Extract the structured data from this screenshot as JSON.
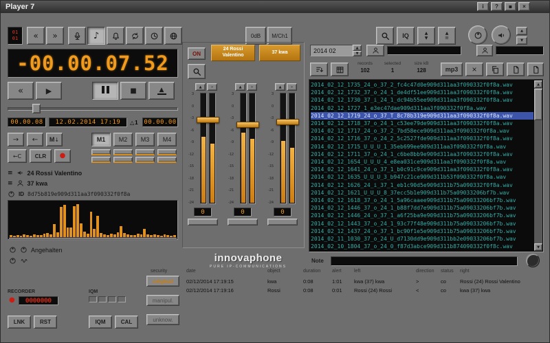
{
  "window": {
    "title": "Player 7",
    "titlebar": {
      "info": "i",
      "help": "?",
      "pin": "▪",
      "close": "×"
    }
  },
  "icons": {
    "prev": "«",
    "next": "»",
    "play": "▶",
    "stop": "■",
    "eject": "▲",
    "note": "♪",
    "record": "●",
    "up": "▲",
    "down": "▼",
    "close": "×",
    "menu": "≡",
    "m": "M",
    "m_arrow": "↓",
    "goto_fwd": "→",
    "goto_back": "←",
    "delta": "△"
  },
  "toolbar": {
    "channel_top": "01",
    "channel_bottom": "01",
    "gain_label": "0dB",
    "mode_label": "M/Ch1",
    "iq_label": "IQ"
  },
  "display": {
    "main": "-00.00.07.52",
    "elapsed": "00.00.08",
    "datetime": "12.02.2014 17:19",
    "take": "1",
    "remaining": "00.00.00"
  },
  "markers": {
    "c_label": "←C",
    "clr_label": "CLR",
    "m1": "M1",
    "m2": "M2",
    "m3": "M3",
    "m4": "M4"
  },
  "call_info": {
    "party_a": "24 Rossi Valentino",
    "party_b": "37 kwa",
    "id_label": "ID",
    "id_value": "8d75b819e909d311aa3f090332f0f8a"
  },
  "waveform": {
    "bars": [
      5,
      3,
      6,
      4,
      7,
      5,
      4,
      8,
      6,
      5,
      9,
      12,
      8,
      38,
      14,
      86,
      92,
      28,
      28,
      88,
      94,
      40,
      16,
      10,
      72,
      24,
      60,
      12,
      8,
      6,
      10,
      7,
      14,
      32,
      11,
      8,
      6,
      5,
      9,
      7,
      24,
      8,
      5,
      7,
      6,
      4,
      8,
      5,
      4,
      6
    ]
  },
  "status": {
    "text": "Angehalten"
  },
  "logo": {
    "name": "innovaphone",
    "tagline": "PURE IP-COMMUNICATIONS"
  },
  "recorder": {
    "label": "RECORDER",
    "counter": "0000000",
    "iqm_label": "IQM",
    "lnk": "LNK",
    "rst": "RST",
    "iqm_btn": "IQM",
    "cal": "CAL"
  },
  "meters": {
    "on_label": "ON",
    "headers": [
      "24 Rossi Valentino",
      "37 kwa"
    ],
    "scale": [
      "3",
      "0",
      "-3",
      "-6",
      "-9",
      "-12",
      "-15",
      "-18",
      "-21",
      "-24"
    ],
    "groups": [
      {
        "levels": [
          60,
          54
        ],
        "fader": 22,
        "value": "0"
      },
      {
        "levels": [
          64,
          58
        ],
        "fader": 26,
        "value": "0"
      },
      {
        "levels": [
          56,
          50
        ],
        "fader": 24,
        "value": "0"
      }
    ]
  },
  "browser": {
    "period": "2014 02",
    "stats": [
      {
        "label": "records",
        "value": "102"
      },
      {
        "label": "selected",
        "value": "1"
      },
      {
        "label": "size kB",
        "value": "128"
      }
    ],
    "mp3_label": "mp3",
    "selected_index": 4,
    "files": [
      "2014_02_12_1735_24_o_37_2_fc4c47d0e909d311aa3f090332f0f8a.wav",
      "2014_02_12_1732_37_o_24_1_de4df51ee909d311aa3f090332f0f8a.wav",
      "2014_02_12_1730_37_i_24_1_dc94b55ee909d311aa3f090332f0f8a.wav",
      "2014_02_12_1727_1_e3ec47dae909d311aa3f090332f0f8a.wav",
      "2014_02_12_1719_24_o_37_T_8c78b319e909d311aa3f090332f0f8a.wav",
      "2014_02_12_1718_37_o_24_1_c53ee79de909d311aa3f090332f0f8a.wav",
      "2014_02_12_1717_24_o_37_2_7bd58ece909d311aa3f090332f0f8a.wav",
      "2014_02_12_1716_37_o_24_2_5c2527fde909d311aa3f090332f0f8a.wav",
      "2014_02_12_1715_U_U_U_1_35eb699ee909d311aa3f090332f0f8a.wav",
      "2014_02_12_1711_37_o_24_1_c6be8bb9e909d311aa3f090332f0f8a.wav",
      "2014_02_12_1654_U_U_U_4_e8ea031ce909d311aa3f090332f0f8a.wav",
      "2014_02_12_1641_24_o_37_1_b0c91c9ce909d311aa3f090332f0f8a.wav",
      "2014_02_12_1635_U_U_U_3_b947c21ce909d311b53f090332f0f8a.wav",
      "2014_02_12_1626_24_i_37_1_eb1c90d5e909d311b75a090332f0f8a.wav",
      "2014_02_12_1621_U_U_U_8_37ecc5b1e909d311b75a09033206bf7b.wav",
      "2014_02_12_1618_37_o_24_1_5a96caaee909d311b75a09033206bf7b.wav",
      "2014_02_12_1446_37_o_24_1_b88f7dd7e909d311b75a09033206bf7b.wav",
      "2014_02_12_1446_24_o_37_1_a6f25ba9e909d311b75a09033206bf7b.wav",
      "2014_02_12_1443_37_o_24_1_93c77f48e909d311b75a09033206bf7b.wav",
      "2014_02_12_1437_24_o_37_1_bc90f1e5e909d311b75a09033206bf7b.wav",
      "2014_02_11_1030_37_o_24_U_d7130dd9e909d311bb2e09033206bf7b.wav",
      "2014_02_10_1804_37_o_24_0_f87d3abce909d311b874090332f0f8c.wav"
    ]
  },
  "note": {
    "label": "Note",
    "value": ""
  },
  "security": {
    "label": "security",
    "options": [
      "original",
      "manipul.",
      "unknow."
    ]
  },
  "calls": {
    "headers": {
      "date": "date",
      "object": "object",
      "duration": "duration",
      "alert": "alert",
      "left": "left",
      "direction": "direction",
      "status": "status",
      "right": "right"
    },
    "rows": [
      {
        "date": "02/12/2014 17:19:15",
        "object": "kwa",
        "duration": "0:08",
        "alert": "1:01",
        "left": "kwa (37) kwa",
        "direction": ">",
        "status": "co",
        "right": "Rossi (24) Rossi Valentino"
      },
      {
        "date": "02/12/2014 17:19:16",
        "object": "Rossi",
        "duration": "0:08",
        "alert": "0:01",
        "left": "Rossi (24) Rossi",
        "direction": "<",
        "status": "co",
        "right": "kwa (37) kwa"
      }
    ]
  }
}
